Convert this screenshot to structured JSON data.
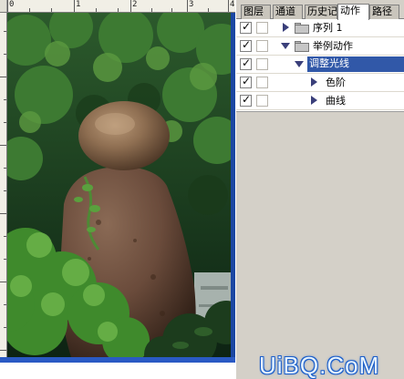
{
  "document": {
    "ruler_numbers": [
      "0",
      "1",
      "2",
      "3",
      "4"
    ],
    "image_description_icon": "photo-canvas"
  },
  "panel": {
    "tabs": [
      {
        "label": "图层",
        "active": false
      },
      {
        "label": "通道",
        "active": false
      },
      {
        "label": "历史记",
        "active": false
      },
      {
        "label": "动作",
        "active": true
      },
      {
        "label": "路径",
        "active": false
      }
    ],
    "rows": [
      {
        "label": "序列 1",
        "type": "set",
        "expanded": false,
        "checked": true
      },
      {
        "label": "举例动作",
        "type": "action",
        "expanded": true,
        "checked": true
      },
      {
        "label": "调整光线",
        "type": "action",
        "expanded": true,
        "checked": true,
        "selected": true
      },
      {
        "label": "色阶",
        "type": "step",
        "expanded": false,
        "checked": true
      },
      {
        "label": "曲线",
        "type": "step",
        "expanded": false,
        "checked": true
      }
    ],
    "checkmark_glyph": "✓"
  },
  "watermark": {
    "text": "UiBQ.CoM"
  },
  "colors": {
    "panel_bg": "#d4d0c8",
    "selection": "#3158a8",
    "doc_frame": "#1f4fb0",
    "watermark_outline": "#1d5fc9"
  }
}
